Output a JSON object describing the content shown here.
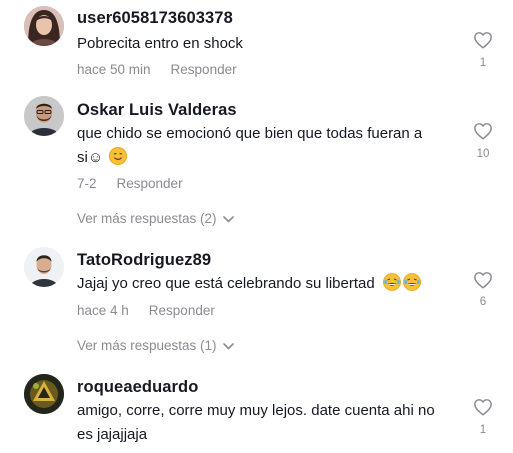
{
  "comments": [
    {
      "username": "user6058173603378",
      "text": "Pobrecita entro en shock",
      "time": "hace 50 min",
      "reply": "Responder",
      "likes": "1",
      "avatar_icon": "avatar-woman-dark-hair"
    },
    {
      "username": "Oskar Luis Valderas",
      "text_line1": "que chido se emocionó que bien que todas fueran a",
      "text_line2": "si☺",
      "emoji": "smiling-face-emoji",
      "time": "7-2",
      "reply": "Responder",
      "likes": "10",
      "more_replies": "Ver más respuestas (2)",
      "avatar_icon": "avatar-man-beard"
    },
    {
      "username": "TatoRodriguez89",
      "text": "Jajaj yo creo que está celebrando su libertad",
      "emoji": "laughing-tears-emoji",
      "time": "hace 4 h",
      "reply": "Responder",
      "likes": "6",
      "more_replies": "Ver más respuestas (1)",
      "avatar_icon": "avatar-man-photo"
    },
    {
      "username": "roqueaeduardo",
      "text_line1": "amigo, corre, corre muy muy lejos. date cuenta ahi no",
      "text_line2": "es jajajjaja",
      "likes": "1",
      "avatar_icon": "avatar-emblem-gold"
    }
  ],
  "colors": {
    "primary_text": "#161823",
    "secondary_text": "#8a8b91",
    "heart_outline": "#8a8b91",
    "emoji_yellow": "#f7c137"
  }
}
